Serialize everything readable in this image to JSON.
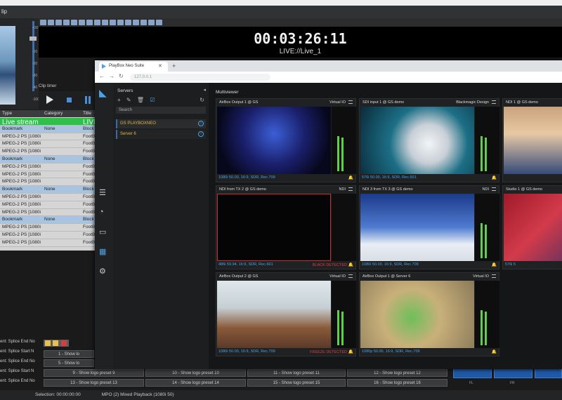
{
  "app": {
    "title_fragment": "lip",
    "timer": "00:03:26:11",
    "live_label": "LIVE://Live_1",
    "clip_timer_label": "Clip timer",
    "volume_marks": [
      "+30",
      "0",
      "-10",
      "-20",
      "-30",
      "-40",
      "-100"
    ]
  },
  "playlist": {
    "headers": [
      "Type",
      "Category",
      "Title"
    ],
    "rows": [
      {
        "type": "Live stream",
        "category": "",
        "title": "LIVE://",
        "kind": "live"
      },
      {
        "type": "Bookmark",
        "category": "None",
        "title": "Block",
        "kind": "bm"
      },
      {
        "type": "MPEG-2 PS [1080i",
        "category": "",
        "title": "FootB",
        "kind": "n"
      },
      {
        "type": "MPEG-2 PS [1080i",
        "category": "",
        "title": "FootB",
        "kind": "n"
      },
      {
        "type": "MPEG-2 PS [1080i",
        "category": "",
        "title": "FootB",
        "kind": "n"
      },
      {
        "type": "Bookmark",
        "category": "None",
        "title": "Block",
        "kind": "bm"
      },
      {
        "type": "MPEG-2 PS [1080i",
        "category": "",
        "title": "FootB",
        "kind": "n"
      },
      {
        "type": "MPEG-2 PS [1080i",
        "category": "",
        "title": "FootB",
        "kind": "n"
      },
      {
        "type": "MPEG-2 PS [1080i",
        "category": "",
        "title": "FootB",
        "kind": "n"
      },
      {
        "type": "Bookmark",
        "category": "None",
        "title": "Block",
        "kind": "bm"
      },
      {
        "type": "MPEG-2 PS [1080i",
        "category": "",
        "title": "FootB",
        "kind": "n"
      },
      {
        "type": "MPEG-2 PS [1080i",
        "category": "",
        "title": "FootB",
        "kind": "n"
      },
      {
        "type": "MPEG-2 PS [1080i",
        "category": "",
        "title": "FootB",
        "kind": "n"
      },
      {
        "type": "Bookmark",
        "category": "None",
        "title": "Block",
        "kind": "bm"
      },
      {
        "type": "MPEG-2 PS [1080i",
        "category": "",
        "title": "FootB",
        "kind": "n"
      },
      {
        "type": "MPEG-2 PS [1080i",
        "category": "",
        "title": "FootB",
        "kind": "n"
      },
      {
        "type": "MPEG-2 PS [1080i",
        "category": "",
        "title": "FootB",
        "kind": "n"
      }
    ]
  },
  "events": [
    "ent: Splice End No",
    "ent: Splice Start N",
    "ent: Splice End No",
    "ent: Splice Start N",
    "ent: Splice End No"
  ],
  "presets": {
    "row_a": [
      "1 - Show lo",
      "5 - Show lo"
    ],
    "row_b": [
      "9 - Show logo preset 9",
      "10 - Show logo preset 10",
      "11 - Show logo preset 11",
      "12 - Show logo preset 12"
    ],
    "row_c": [
      "13 - Show logo preset 13",
      "14 - Show logo preset 14",
      "15 - Show logo preset 15",
      "16 - Show logo preset 16"
    ]
  },
  "fl_labels": [
    "FL",
    "FR"
  ],
  "status": {
    "selection": "Selection: 00:00:00:00",
    "mode": "MPO (2) Mixed Playback (1080i 50)"
  },
  "browser": {
    "tab_title": "PlayBox Neo Suite",
    "url": "127.0.0.1"
  },
  "servers": {
    "title": "Servers",
    "search": "Search",
    "items": [
      "GS PLAYBOXNEO",
      "Server 6"
    ]
  },
  "multiviewer": {
    "title": "Multiviewer",
    "tiles": [
      {
        "name": "AirBox Output 1 @ GS",
        "device": "Virtual IO",
        "format": "1080i 50.00, 16:9, SDR, Rec.709",
        "alert": ""
      },
      {
        "name": "SDI input 1 @ GS demo",
        "device": "Blackmagic Design",
        "format": "576i 50.00, 16:9, SDR, Rec.601",
        "alert": ""
      },
      {
        "name": "NDI 1 @ GS demo",
        "device": "",
        "format": "",
        "alert": ""
      },
      {
        "name": "NDI from TX 2 @ GS demo",
        "device": "NDI",
        "format": "486i 59.94, 16:9, SDR, Rec.601",
        "alert": "BLACK DETECTED"
      },
      {
        "name": "NDI 3 from TX 3 @ GS demo",
        "device": "NDI",
        "format": "1080i 50.00, 16:9, SDR, Rec.709",
        "alert": ""
      },
      {
        "name": "Studio 1 @ GS demo",
        "device": "",
        "format": "576i 5",
        "alert": ""
      },
      {
        "name": "AirBox Output 2 @ GS",
        "device": "Virtual IO",
        "format": "1080i 50.00, 16:9, SDR, Rec.709",
        "alert": "FREEZE DETECTED"
      },
      {
        "name": "AirBox Output 1 @ Server 6",
        "device": "Virtual IO",
        "format": "1080p 50.00, 16:9, SDR, Rec.709",
        "alert": ""
      }
    ]
  },
  "colors": {
    "accent": "#4aa3e8",
    "live": "#2fc04a",
    "alert": "#e03c3c",
    "server": "#e1b84a"
  }
}
